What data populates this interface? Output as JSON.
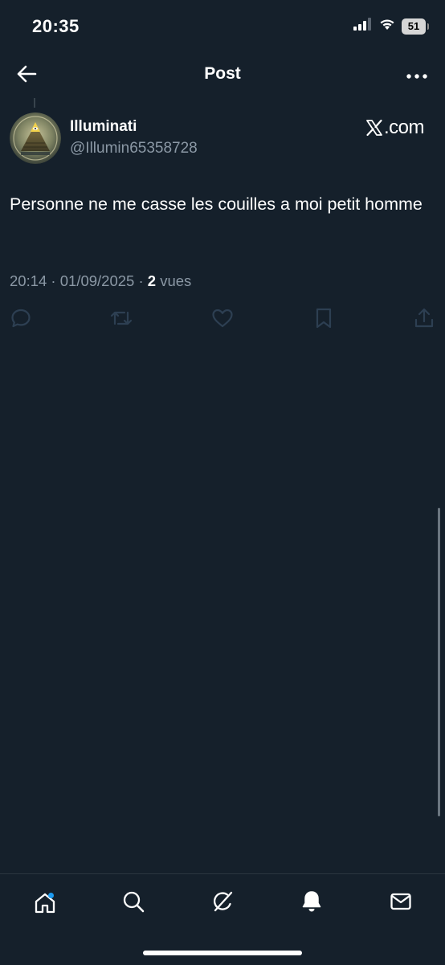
{
  "status_bar": {
    "time": "20:35",
    "battery": "51"
  },
  "header": {
    "title": "Post"
  },
  "post": {
    "display_name": "Illuminati",
    "handle": "@Illumin65358728",
    "source": ".com",
    "text": "Personne ne me casse les couilles a moi petit homme",
    "timestamp": "20:14 · 01/09/2025 · ",
    "views_count": "2",
    "views_label": " vues"
  },
  "colors": {
    "background": "#15202b",
    "text_primary": "#ffffff",
    "text_secondary": "#8b98a5",
    "icon_muted": "#2d3f52",
    "accent": "#1d9bf0"
  },
  "icons": {
    "back": "arrow-left-icon",
    "more": "ellipsis-icon",
    "reply": "reply-icon",
    "repost": "repost-icon",
    "like": "heart-icon",
    "bookmark": "bookmark-icon",
    "share": "share-icon",
    "home": "home-icon",
    "search": "search-icon",
    "grok": "grok-icon",
    "notifications": "bell-icon",
    "messages": "mail-icon"
  }
}
